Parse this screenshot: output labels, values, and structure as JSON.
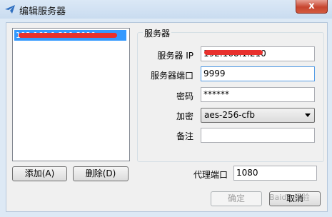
{
  "window": {
    "title": "编辑服务器",
    "close_glyph": "x"
  },
  "server_list": {
    "items": [
      {
        "label": "192.168.1.210:8090"
      }
    ]
  },
  "list_buttons": {
    "add": "添加(A)",
    "delete": "删除(D)"
  },
  "server_group": {
    "title": "服务器",
    "ip_label": "服务器 IP",
    "ip_value": "192.168.1.210",
    "port_label": "服务器端口",
    "port_value": "9999",
    "password_label": "密码",
    "password_value": "******",
    "encryption_label": "加密",
    "encryption_value": "aes-256-cfb",
    "remark_label": "备注",
    "remark_value": ""
  },
  "proxy": {
    "port_label": "代理端口",
    "port_value": "1080"
  },
  "dialog_buttons": {
    "ok": "确定",
    "cancel": "取消"
  },
  "watermark": {
    "text": "Baidu 经验"
  },
  "colors": {
    "selection": "#3399ff",
    "redaction": "#e8312d",
    "close_button": "#c7452f"
  }
}
